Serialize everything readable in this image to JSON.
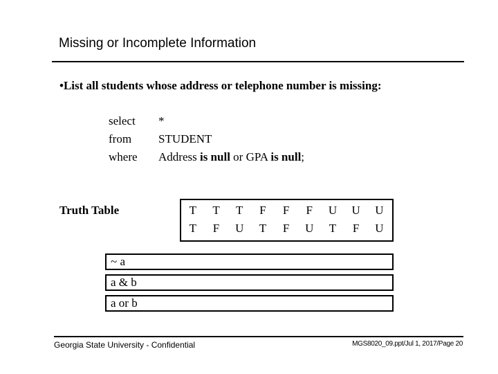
{
  "slide": {
    "title": "Missing or Incomplete Information",
    "bullet": "•List all students whose address or telephone number is missing:"
  },
  "sql": {
    "lines": [
      {
        "keyword": "select",
        "parts": [
          {
            "text": "*",
            "bold": false
          }
        ]
      },
      {
        "keyword": "from",
        "parts": [
          {
            "text": "STUDENT",
            "bold": false
          }
        ]
      },
      {
        "keyword": "where",
        "parts": [
          {
            "text": "Address ",
            "bold": false
          },
          {
            "text": "is null",
            "bold": true
          },
          {
            "text": " or GPA ",
            "bold": false
          },
          {
            "text": "is null",
            "bold": true
          },
          {
            "text": ";",
            "bold": false
          }
        ]
      }
    ]
  },
  "truth_table": {
    "label": "Truth Table",
    "row_a": [
      "T",
      "T",
      "T",
      "F",
      "F",
      "F",
      "U",
      "U",
      "U"
    ],
    "row_b": [
      "T",
      "F",
      "U",
      "T",
      "F",
      "U",
      "T",
      "F",
      "U"
    ],
    "operations": [
      "~ a",
      "a & b",
      "a or b"
    ]
  },
  "footer": {
    "left": "Georgia State University - Confidential",
    "right": "MGS8020_09.ppt/Jul 1, 2017/Page 20"
  }
}
